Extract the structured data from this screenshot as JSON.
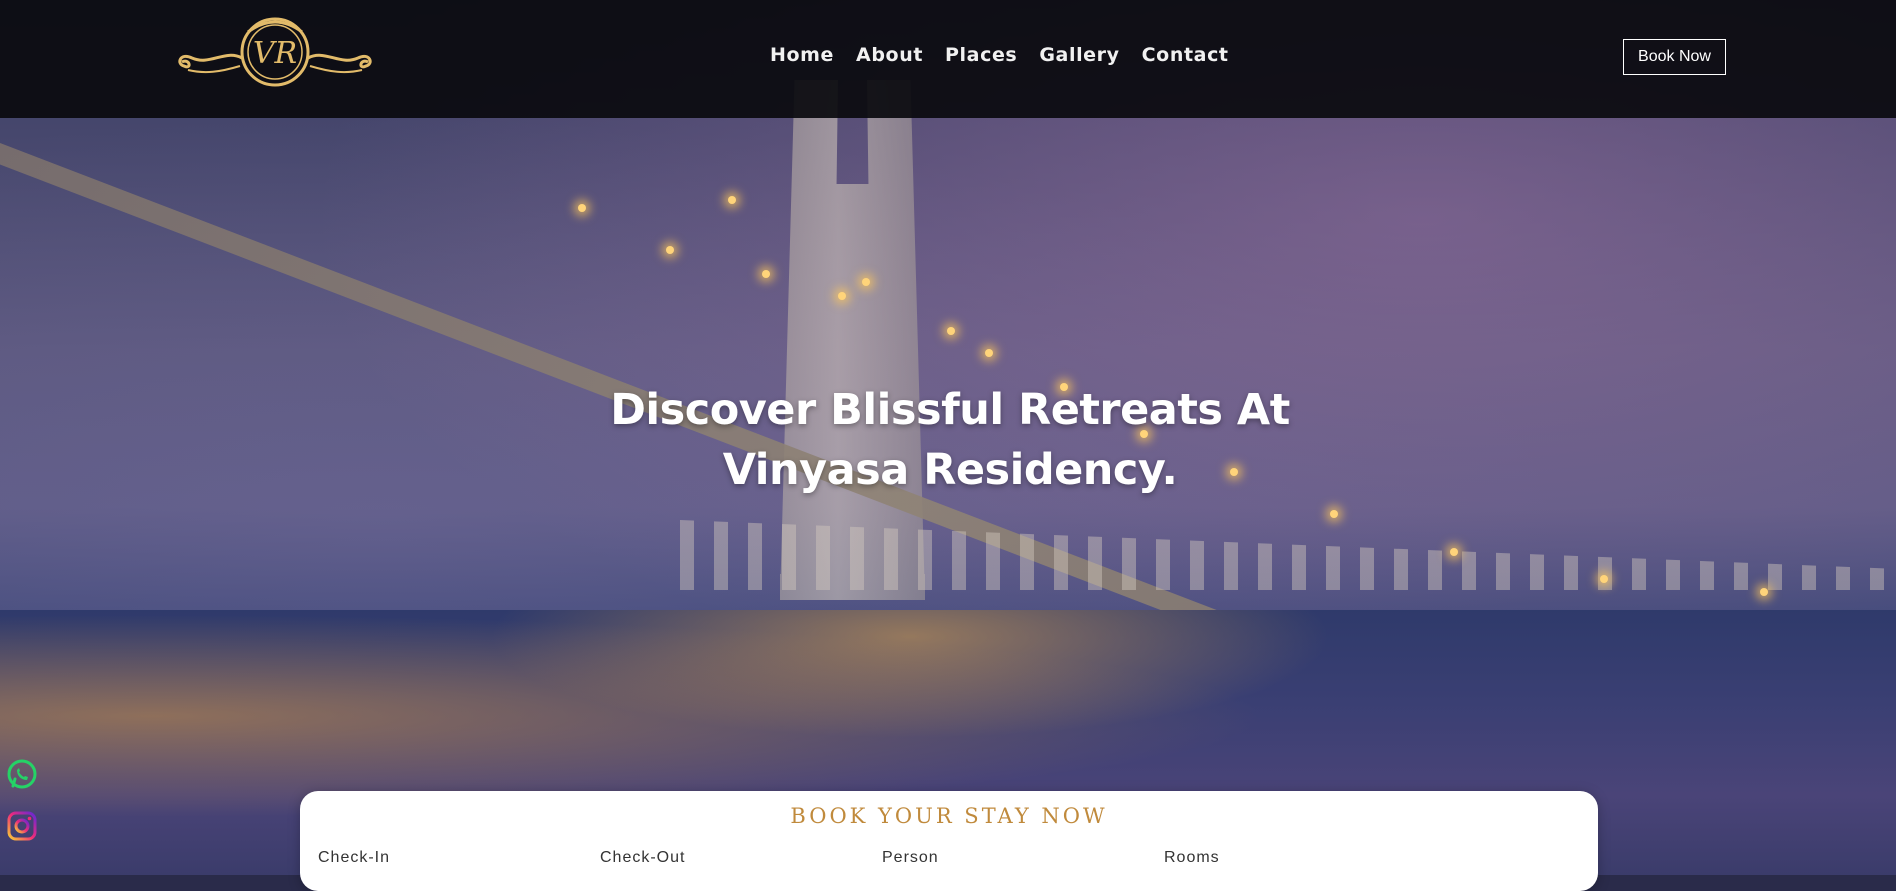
{
  "header": {
    "logo_alt": "VR",
    "nav": [
      "Home",
      "About",
      "Places",
      "Gallery",
      "Contact"
    ],
    "book_button": "Book Now"
  },
  "hero": {
    "headline_line1": "Discover Blissful Retreats At",
    "headline_line2": "Vinyasa Residency."
  },
  "booking": {
    "title": "BOOK YOUR STAY NOW",
    "fields": [
      "Check-In",
      "Check-Out",
      "Person",
      "Rooms"
    ]
  },
  "social": {
    "icons": [
      "whatsapp-icon",
      "instagram-icon"
    ]
  },
  "colors": {
    "gold": "#e2bb6a",
    "booking_title": "#c08a3c",
    "whatsapp_green": "#25d366",
    "header_bg": "#0a0a0e"
  }
}
